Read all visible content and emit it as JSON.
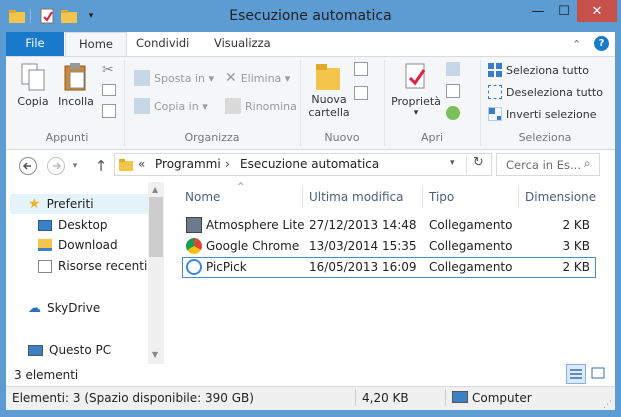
{
  "window": {
    "title": "Esecuzione automatica",
    "controls": {
      "minimize": "—",
      "maximize": "☐",
      "close": "✕"
    }
  },
  "ribbon_tabs": [
    "File",
    "Home",
    "Condividi",
    "Visualizza"
  ],
  "ribbon": {
    "appunti": {
      "label": "Appunti",
      "copia": "Copia",
      "incolla": "Incolla"
    },
    "organizza": {
      "label": "Organizza",
      "sposta_in": "Sposta in ▾",
      "copia_in": "Copia in ▾",
      "elimina": "Elimina ▾",
      "rinomina": "Rinomina"
    },
    "nuovo": {
      "label": "Nuovo",
      "nuova_cartella_1": "Nuova",
      "nuova_cartella_2": "cartella"
    },
    "apri": {
      "label": "Apri",
      "proprieta": "Proprietà"
    },
    "seleziona": {
      "label": "Seleziona",
      "seleziona_tutto": "Seleziona tutto",
      "deseleziona_tutto": "Deseleziona tutto",
      "inverti_selezione": "Inverti selezione"
    }
  },
  "address": {
    "prefix": "«",
    "crumbs": [
      "Programmi",
      "Esecuzione automatica"
    ],
    "separator": "›",
    "search_placeholder": "Cerca in Es..."
  },
  "nav": {
    "preferiti": "Preferiti",
    "items": [
      "Desktop",
      "Download",
      "Risorse recenti"
    ],
    "skydrive": "SkyDrive",
    "questo_pc": "Questo PC"
  },
  "columns": {
    "name": "Nome",
    "modified": "Ultima modifica",
    "type": "Tipo",
    "size": "Dimensione"
  },
  "files": [
    {
      "name": "Atmosphere Lite",
      "modified": "27/12/2013 14:48",
      "type": "Collegamento",
      "size": "2 KB"
    },
    {
      "name": "Google Chrome",
      "modified": "13/03/2014 15:35",
      "type": "Collegamento",
      "size": "3 KB"
    },
    {
      "name": "PicPick",
      "modified": "16/05/2013 16:09",
      "type": "Collegamento",
      "size": "2 KB"
    }
  ],
  "status": {
    "count": "3 elementi"
  },
  "details_bar": {
    "items": "Elementi: 3 (Spazio disponibile: 390 GB)",
    "size": "4,20 KB",
    "location": "Computer"
  },
  "colors": {
    "accent": "#1979ca",
    "frame": "#5d9bd3",
    "close": "#c7504b",
    "selection": "#4b8bd2"
  }
}
